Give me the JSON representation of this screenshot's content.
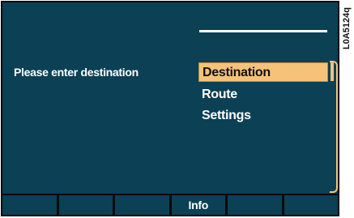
{
  "screen": {
    "prompt": "Please enter destination",
    "menu": {
      "items": [
        {
          "label": "Destination",
          "selected": true
        },
        {
          "label": "Route",
          "selected": false
        },
        {
          "label": "Settings",
          "selected": false
        }
      ]
    },
    "softkeys": [
      "",
      "",
      "",
      "Info",
      "",
      ""
    ]
  },
  "doc_code": "L0A5124q",
  "colors": {
    "background": "#0b4055",
    "highlight": "#f6c27a",
    "text": "#ffffff"
  }
}
